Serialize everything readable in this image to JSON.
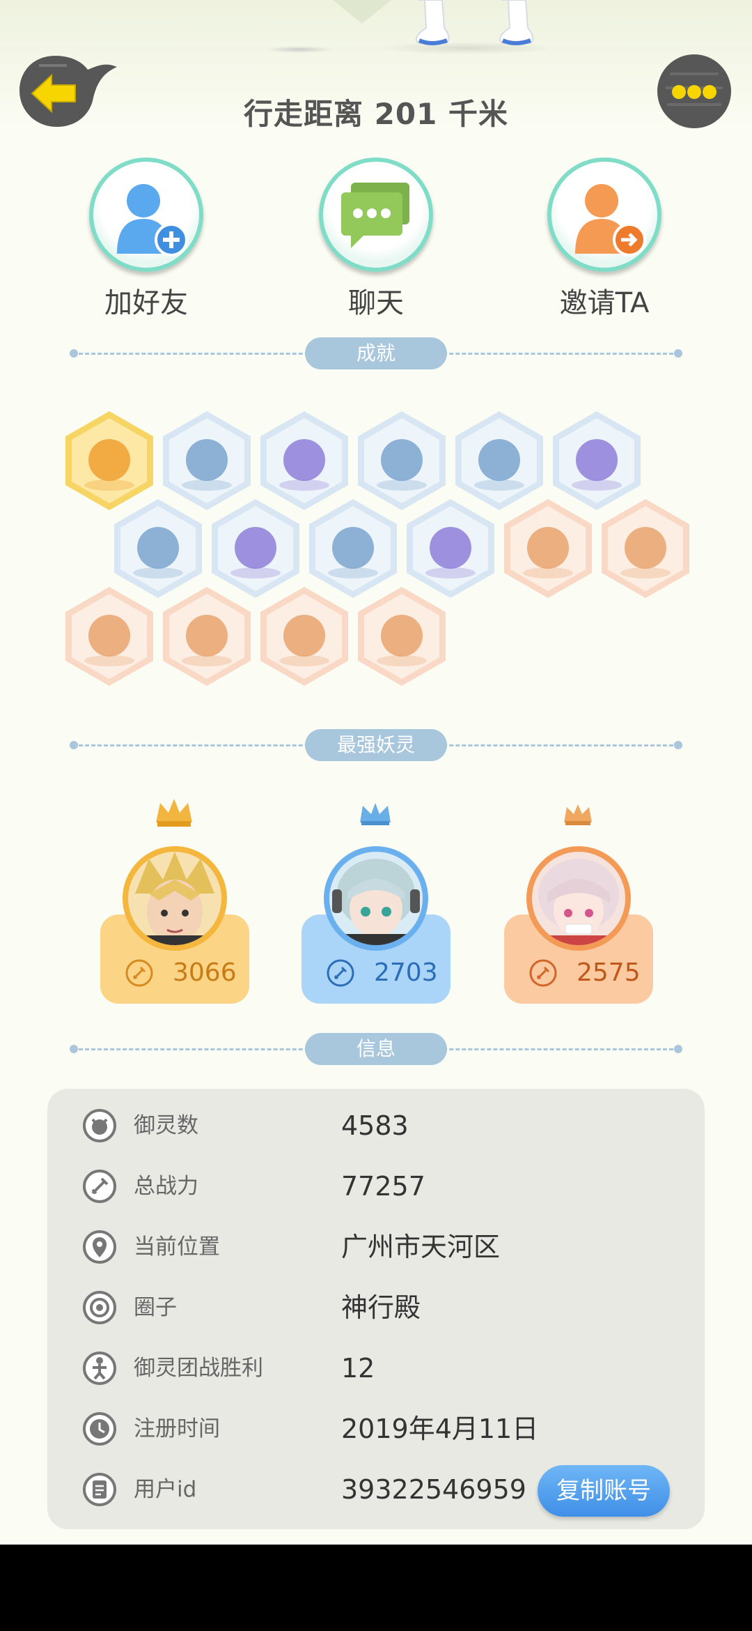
{
  "header": {
    "title": "行走距离 201 千米",
    "back_icon": "back-arrow-icon",
    "more_icon": "more-dots-icon"
  },
  "actions": [
    {
      "label": "加好友",
      "icon": "add-friend-icon"
    },
    {
      "label": "聊天",
      "icon": "chat-icon"
    },
    {
      "label": "邀请TA",
      "icon": "invite-icon"
    }
  ],
  "sections": {
    "achievements": "成就",
    "strongest": "最强妖灵",
    "info": "信息"
  },
  "achievements": {
    "badges": [
      "fox-face-badge-icon",
      "sneaker-badge-icon",
      "radar-badge-icon",
      "moon-badge-icon",
      "crystal-ball-badge-icon",
      "yinyang-wave-badge-icon",
      "creature-badge-icon",
      "cart-badge-icon",
      "cat-balloon-badge-icon",
      "yinyang-box-badge-icon",
      "egg-badge-icon",
      "fish-dragon-badge-icon",
      "shield-badge-icon",
      "demon-statue-badge-icon",
      "cat-duo-badge-icon",
      "fox-book-badge-icon"
    ]
  },
  "spirits": [
    {
      "power": "3066",
      "rank_color": "#f7c66e"
    },
    {
      "power": "2703",
      "rank_color": "#9fcdf5"
    },
    {
      "power": "2575",
      "rank_color": "#f7c399"
    }
  ],
  "info": {
    "rows": [
      {
        "label": "御灵数",
        "value": "4583",
        "icon": "spirit-count-icon"
      },
      {
        "label": "总战力",
        "value": "77257",
        "icon": "sword-icon"
      },
      {
        "label": "当前位置",
        "value": "广州市天河区",
        "icon": "location-pin-icon"
      },
      {
        "label": "圈子",
        "value": "神行殿",
        "icon": "circle-target-icon"
      },
      {
        "label": "御灵团战胜利",
        "value": "12",
        "icon": "trophy-figure-icon"
      },
      {
        "label": "注册时间",
        "value": "2019年4月11日",
        "icon": "clock-icon"
      },
      {
        "label": "用户id",
        "value": "39322546959",
        "icon": "user-id-icon"
      }
    ],
    "copy_button": "复制账号"
  }
}
